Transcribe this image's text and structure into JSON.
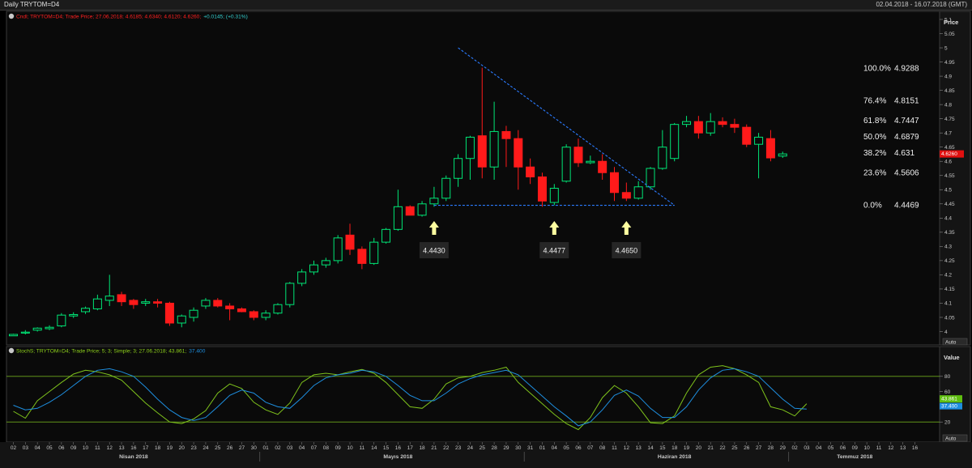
{
  "window": {
    "title": "Daily TRYTOM=D4",
    "date_range": "02.04.2018 - 16.07.2018 (GMT)"
  },
  "price_panel": {
    "legend_prefix": "Cndl; TRYTOM=D4; Trade Price; 27.06.2018; 4.6185; 4.6340; 4.6120; 4.6260;",
    "legend_change": "+0.0145; (+0.31%)",
    "axis_title": "Price",
    "last_price_tag": "4.6260",
    "auto_label": "Auto"
  },
  "stoch_panel": {
    "legend_prefix": "StochS; TRYTOM=D4; Trade Price; 5; 3; Simple; 3; 27.06.2018; 43.861;",
    "legend_value2": "37.400",
    "axis_title": "Value",
    "k_tag": "43.861",
    "d_tag": "37.400",
    "auto_label": "Auto"
  },
  "colors": {
    "up": "#00e676",
    "down": "#ff1a1a",
    "trend": "#2b7bff",
    "stoch_k": "#7fc31c",
    "stoch_d": "#1e8fe0",
    "arrow": "#ffffa0"
  },
  "chart_data": [
    {
      "type": "candlestick",
      "title": "",
      "ylabel": "Price",
      "ylim": [
        3.97,
        5.1
      ],
      "y_ticks": [
        "4",
        "4.05",
        "4.1",
        "4.15",
        "4.2",
        "4.25",
        "4.3",
        "4.35",
        "4.4",
        "4.45",
        "4.5",
        "4.55",
        "4.6",
        "4.65",
        "4.7",
        "4.75",
        "4.8",
        "4.85",
        "4.9",
        "4.95",
        "5",
        "5.05",
        "5.1"
      ],
      "x_tick_labels": [
        "02",
        "03",
        "04",
        "05",
        "06",
        "09",
        "10",
        "11",
        "12",
        "13",
        "16",
        "17",
        "18",
        "19",
        "20",
        "23",
        "24",
        "25",
        "26",
        "27",
        "30",
        "01",
        "02",
        "03",
        "04",
        "07",
        "08",
        "09",
        "10",
        "11",
        "14",
        "15",
        "16",
        "17",
        "18",
        "21",
        "22",
        "23",
        "24",
        "25",
        "28",
        "29",
        "30",
        "31",
        "01",
        "04",
        "05",
        "06",
        "07",
        "08",
        "11",
        "12",
        "13",
        "14",
        "15",
        "18",
        "19",
        "20",
        "21",
        "22",
        "25",
        "26",
        "27",
        "28",
        "29",
        "02",
        "03",
        "04",
        "05",
        "06",
        "09",
        "10",
        "11",
        "12",
        "13",
        "16"
      ],
      "month_labels": [
        {
          "label": "Nisan 2018",
          "index": 10
        },
        {
          "label": "Mayıs 2018",
          "index": 32
        },
        {
          "label": "Haziran 2018",
          "index": 55
        },
        {
          "label": "Temmuz 2018",
          "index": 70
        }
      ],
      "candles": [
        [
          3.985,
          3.985,
          3.99,
          3.992
        ],
        [
          3.995,
          3.99,
          3.998,
          4.005
        ],
        [
          4.005,
          4.0,
          4.012,
          4.015
        ],
        [
          4.01,
          4.005,
          4.015,
          4.022
        ],
        [
          4.02,
          4.015,
          4.058,
          4.065
        ],
        [
          4.055,
          4.048,
          4.06,
          4.068
        ],
        [
          4.07,
          4.062,
          4.082,
          4.088
        ],
        [
          4.08,
          4.075,
          4.115,
          4.13
        ],
        [
          4.11,
          4.09,
          4.125,
          4.2
        ],
        [
          4.13,
          4.09,
          4.105,
          4.14
        ],
        [
          4.11,
          4.08,
          4.095,
          4.115
        ],
        [
          4.1,
          4.09,
          4.105,
          4.115
        ],
        [
          4.105,
          4.085,
          4.1,
          4.115
        ],
        [
          4.1,
          4.02,
          4.03,
          4.105
        ],
        [
          4.03,
          4.015,
          4.055,
          4.06
        ],
        [
          4.05,
          4.035,
          4.075,
          4.085
        ],
        [
          4.09,
          4.08,
          4.11,
          4.118
        ],
        [
          4.11,
          4.085,
          4.09,
          4.118
        ],
        [
          4.09,
          4.04,
          4.08,
          4.1
        ],
        [
          4.08,
          4.068,
          4.07,
          4.085
        ],
        [
          4.07,
          4.04,
          4.05,
          4.075
        ],
        [
          4.05,
          4.04,
          4.065,
          4.075
        ],
        [
          4.065,
          4.06,
          4.095,
          4.1
        ],
        [
          4.095,
          4.085,
          4.17,
          4.175
        ],
        [
          4.17,
          4.16,
          4.21,
          4.22
        ],
        [
          4.21,
          4.2,
          4.235,
          4.25
        ],
        [
          4.235,
          4.225,
          4.25,
          4.26
        ],
        [
          4.25,
          4.24,
          4.33,
          4.34
        ],
        [
          4.34,
          4.27,
          4.29,
          4.38
        ],
        [
          4.29,
          4.22,
          4.24,
          4.3
        ],
        [
          4.24,
          4.235,
          4.315,
          4.33
        ],
        [
          4.315,
          4.31,
          4.36,
          4.365
        ],
        [
          4.36,
          4.355,
          4.44,
          4.5
        ],
        [
          4.44,
          4.41,
          4.41,
          4.445
        ],
        [
          4.41,
          4.405,
          4.45,
          4.46
        ],
        [
          4.45,
          4.44,
          4.47,
          4.51
        ],
        [
          4.47,
          4.46,
          4.54,
          4.55
        ],
        [
          4.54,
          4.51,
          4.61,
          4.625
        ],
        [
          4.61,
          4.535,
          4.685,
          4.69
        ],
        [
          4.69,
          4.54,
          4.58,
          4.93
        ],
        [
          4.58,
          4.535,
          4.705,
          4.81
        ],
        [
          4.705,
          4.58,
          4.68,
          4.725
        ],
        [
          4.68,
          4.5,
          4.58,
          4.71
        ],
        [
          4.58,
          4.52,
          4.545,
          4.61
        ],
        [
          4.545,
          4.44,
          4.46,
          4.56
        ],
        [
          4.455,
          4.445,
          4.505,
          4.52
        ],
        [
          4.53,
          4.525,
          4.65,
          4.66
        ],
        [
          4.65,
          4.58,
          4.595,
          4.68
        ],
        [
          4.595,
          4.59,
          4.6,
          4.62
        ],
        [
          4.6,
          4.535,
          4.56,
          4.625
        ],
        [
          4.56,
          4.46,
          4.49,
          4.58
        ],
        [
          4.49,
          4.46,
          4.47,
          4.525
        ],
        [
          4.47,
          4.465,
          4.51,
          4.53
        ],
        [
          4.51,
          4.5,
          4.575,
          4.58
        ],
        [
          4.575,
          4.57,
          4.65,
          4.71
        ],
        [
          4.61,
          4.6,
          4.73,
          4.735
        ],
        [
          4.73,
          4.72,
          4.74,
          4.76
        ],
        [
          4.74,
          4.68,
          4.7,
          4.76
        ],
        [
          4.7,
          4.69,
          4.74,
          4.77
        ],
        [
          4.74,
          4.72,
          4.73,
          4.755
        ],
        [
          4.73,
          4.7,
          4.72,
          4.75
        ],
        [
          4.72,
          4.65,
          4.66,
          4.73
        ],
        [
          4.66,
          4.54,
          4.685,
          4.7
        ],
        [
          4.68,
          4.6,
          4.612,
          4.71
        ],
        [
          4.6185,
          4.612,
          4.626,
          4.634
        ]
      ],
      "fibonacci": [
        {
          "label": "100.0%",
          "value": "4.9288"
        },
        {
          "label": "76.4%",
          "value": "4.8151"
        },
        {
          "label": "61.8%",
          "value": "4.7447"
        },
        {
          "label": "50.0%",
          "value": "4.6879"
        },
        {
          "label": "38.2%",
          "value": "4.631"
        },
        {
          "label": "23.6%",
          "value": "4.5606"
        },
        {
          "label": "0.0%",
          "value": "4.4469"
        }
      ],
      "trendlines": [
        {
          "from": {
            "index": 37,
            "price": 5.0
          },
          "to": {
            "index": 55,
            "price": 4.445
          }
        },
        {
          "from": {
            "index": 35,
            "price": 4.445
          },
          "to": {
            "index": 55,
            "price": 4.445
          }
        }
      ],
      "annotations": [
        {
          "text": "4.4430",
          "index": 35
        },
        {
          "text": "4.4477",
          "index": 45
        },
        {
          "text": "4.4650",
          "index": 51
        }
      ]
    },
    {
      "type": "line",
      "title": "",
      "ylabel": "Value",
      "ylim": [
        0,
        100
      ],
      "y_ticks": [
        "20",
        "40",
        "60",
        "80"
      ],
      "reference_lines": [
        20,
        80
      ],
      "series": [
        {
          "values": [
            34,
            25,
            48,
            60,
            72,
            83,
            88,
            86,
            82,
            75,
            60,
            45,
            32,
            20,
            18,
            24,
            35,
            58,
            70,
            64,
            46,
            36,
            30,
            45,
            72,
            82,
            84,
            82,
            86,
            89,
            84,
            72,
            56,
            40,
            38,
            50,
            70,
            78,
            80,
            85,
            88,
            92,
            72,
            58,
            44,
            30,
            18,
            10,
            26,
            52,
            68,
            58,
            40,
            19,
            18,
            28,
            58,
            82,
            92,
            94,
            90,
            82,
            72,
            40,
            36,
            28,
            44
          ]
        },
        {
          "values": [
            42,
            36,
            38,
            46,
            56,
            68,
            80,
            88,
            90,
            86,
            80,
            66,
            50,
            36,
            26,
            22,
            26,
            40,
            55,
            62,
            58,
            46,
            40,
            38,
            52,
            68,
            78,
            82,
            84,
            88,
            86,
            80,
            68,
            55,
            48,
            48,
            58,
            70,
            77,
            82,
            85,
            88,
            82,
            68,
            54,
            40,
            28,
            15,
            20,
            36,
            55,
            62,
            54,
            38,
            26,
            26,
            40,
            62,
            78,
            88,
            90,
            86,
            80,
            65,
            50,
            38,
            37
          ]
        }
      ]
    }
  ]
}
